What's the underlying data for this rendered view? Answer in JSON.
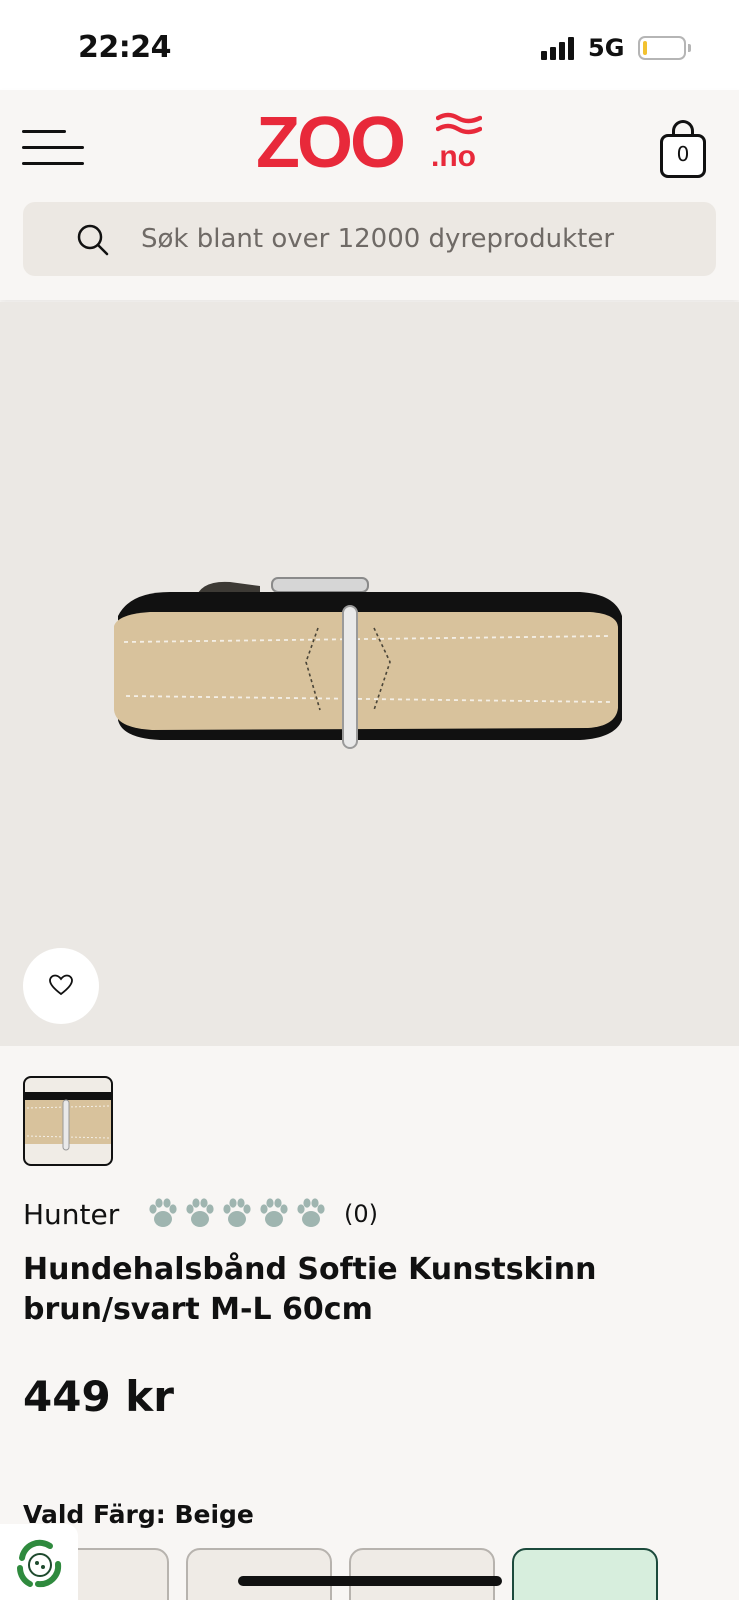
{
  "status_bar": {
    "time": "22:24",
    "network": "5G",
    "battery_level": 0.1
  },
  "header": {
    "logo_text": "ZOO",
    "logo_suffix": ".no",
    "cart_count": "0",
    "search_placeholder": "Søk blant over 12000 dyreprodukter"
  },
  "product": {
    "brand": "Hunter",
    "rating_count": "(0)",
    "rating_value": 0,
    "rating_max": 5,
    "title": "Hundehalsbånd Softie Kunstskinn brun/svart M-L 60cm",
    "price": "449 kr",
    "variant_label": "Vald Färg:",
    "variant_value": "Beige"
  },
  "colors": {
    "brand_red": "#e8293a",
    "paw_inactive": "#9fb5b0",
    "collar_beige": "#d8c29c",
    "selected_swatch": "#d7eedd"
  },
  "icons": {
    "menu": "hamburger-icon",
    "cart": "shopping-bag-icon",
    "search": "search-icon",
    "favorite": "heart-icon",
    "rating": "paw-icon",
    "eco": "recycle-icon"
  }
}
